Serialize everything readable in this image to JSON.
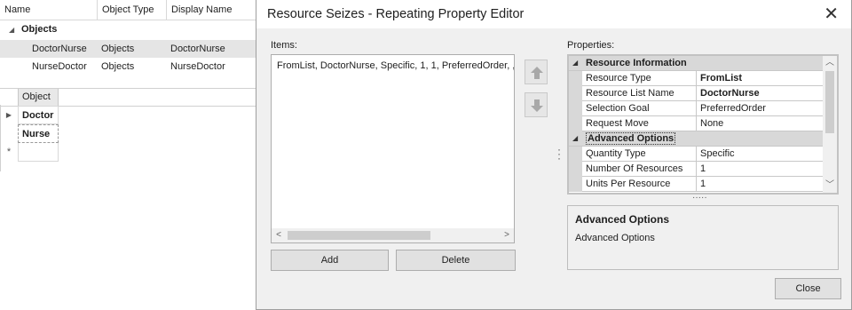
{
  "background": {
    "columns": [
      "Name",
      "Object Type",
      "Display Name"
    ],
    "group": {
      "label": "Objects"
    },
    "rows": [
      {
        "name": "DoctorNurse",
        "type": "Objects",
        "display": "DoctorNurse"
      },
      {
        "name": "NurseDoctor",
        "type": "Objects",
        "display": "NurseDoctor"
      }
    ],
    "lower_grid": {
      "header": "Object",
      "rows": [
        "Doctor",
        "Nurse",
        ""
      ]
    }
  },
  "dialog": {
    "title": "Resource Seizes - Repeating Property Editor",
    "items_label": "Items:",
    "properties_label": "Properties:",
    "items": [
      "FromList, DoctorNurse, Specific, 1, 1, PreferredOrder, ,"
    ],
    "add_label": "Add",
    "delete_label": "Delete",
    "close_label": "Close",
    "properties": {
      "categories": [
        {
          "name": "Resource Information",
          "rows": [
            {
              "name": "Resource Type",
              "value": "FromList",
              "bold": true
            },
            {
              "name": "Resource List Name",
              "value": "DoctorNurse",
              "bold": true
            },
            {
              "name": "Selection Goal",
              "value": "PreferredOrder",
              "bold": false
            },
            {
              "name": "Request Move",
              "value": "None",
              "bold": false
            }
          ]
        },
        {
          "name": "Advanced Options",
          "rows": [
            {
              "name": "Quantity Type",
              "value": "Specific",
              "bold": false
            },
            {
              "name": "Number Of Resources",
              "value": "1",
              "bold": false
            },
            {
              "name": "Units Per Resource",
              "value": "1",
              "bold": false
            }
          ]
        }
      ]
    },
    "description": {
      "title": "Advanced Options",
      "text": "Advanced Options"
    }
  },
  "icons": {
    "close": "close-icon",
    "move_up": "arrow-up-icon",
    "move_down": "arrow-down-icon"
  }
}
